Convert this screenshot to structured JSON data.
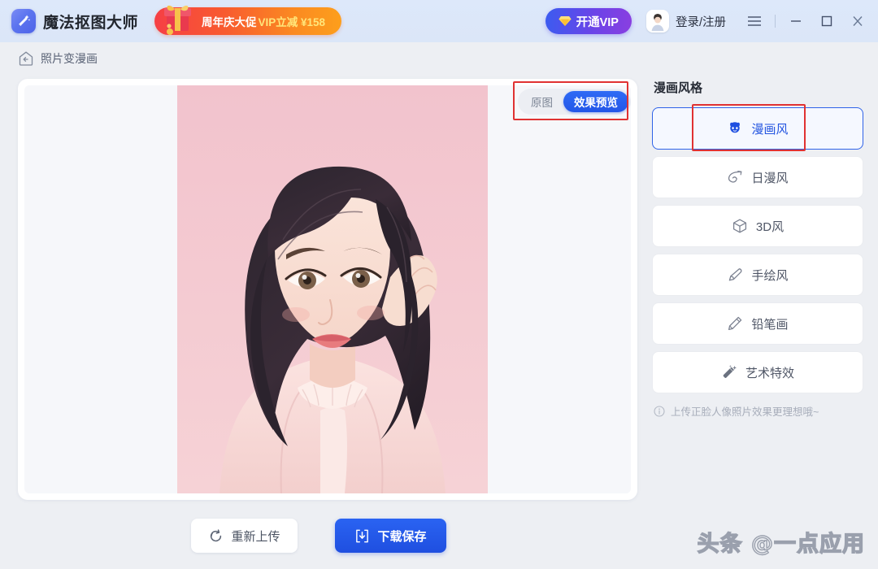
{
  "titlebar": {
    "app_name": "魔法抠图大师",
    "logo_icon": "magic-wand-logo",
    "promo": {
      "icon": "gift-box-icon",
      "text_primary": "周年庆大促",
      "text_accent": "VIP立减 ¥158",
      "color_start": "#f63f45",
      "color_end": "#fd9f1c"
    },
    "vip_button": {
      "label": "开通VIP",
      "icon": "diamond-icon",
      "color_start": "#3b5cf0",
      "color_end": "#8a3fe0"
    },
    "account": {
      "label": "登录/注册",
      "avatar_icon": "user-avatar"
    },
    "menu_icon": "hamburger-menu-icon",
    "minimize_icon": "minimize-icon",
    "maximize_icon": "maximize-icon",
    "close_icon": "close-icon",
    "background_color": "#dce7f8"
  },
  "breadcrumb": {
    "icon": "back-home-icon",
    "label": "照片变漫画"
  },
  "preview": {
    "toggle": {
      "options": [
        "原图",
        "效果预览"
      ],
      "selected": "效果预览",
      "selected_color": "#2356e8"
    },
    "image_alt": "anime-style portrait on pink background"
  },
  "panel": {
    "title": "漫画风格",
    "styles": [
      {
        "label": "漫画风",
        "icon": "comic-mask-icon",
        "selected": true
      },
      {
        "label": "日漫风",
        "icon": "leaf-swirl-icon",
        "selected": false
      },
      {
        "label": "3D风",
        "icon": "cube-icon",
        "selected": false
      },
      {
        "label": "手绘风",
        "icon": "brush-pen-icon",
        "selected": false
      },
      {
        "label": "铅笔画",
        "icon": "pencil-icon",
        "selected": false
      },
      {
        "label": "艺术特效",
        "icon": "magic-wand-icon",
        "selected": false
      }
    ],
    "hint": {
      "icon": "info-circle-icon",
      "text": "上传正脸人像照片效果更理想哦~"
    },
    "accent_color": "#2455e0"
  },
  "actions": {
    "reupload": {
      "label": "重新上传",
      "icon": "refresh-icon"
    },
    "download": {
      "label": "下载保存",
      "icon": "download-icon",
      "color": "#1f4fe0"
    }
  },
  "annotations": {
    "box_color": "#e03232",
    "boxes": [
      "preview-toggle",
      "comic-style-option"
    ]
  },
  "watermark": {
    "text": "头条 @一点应用"
  }
}
